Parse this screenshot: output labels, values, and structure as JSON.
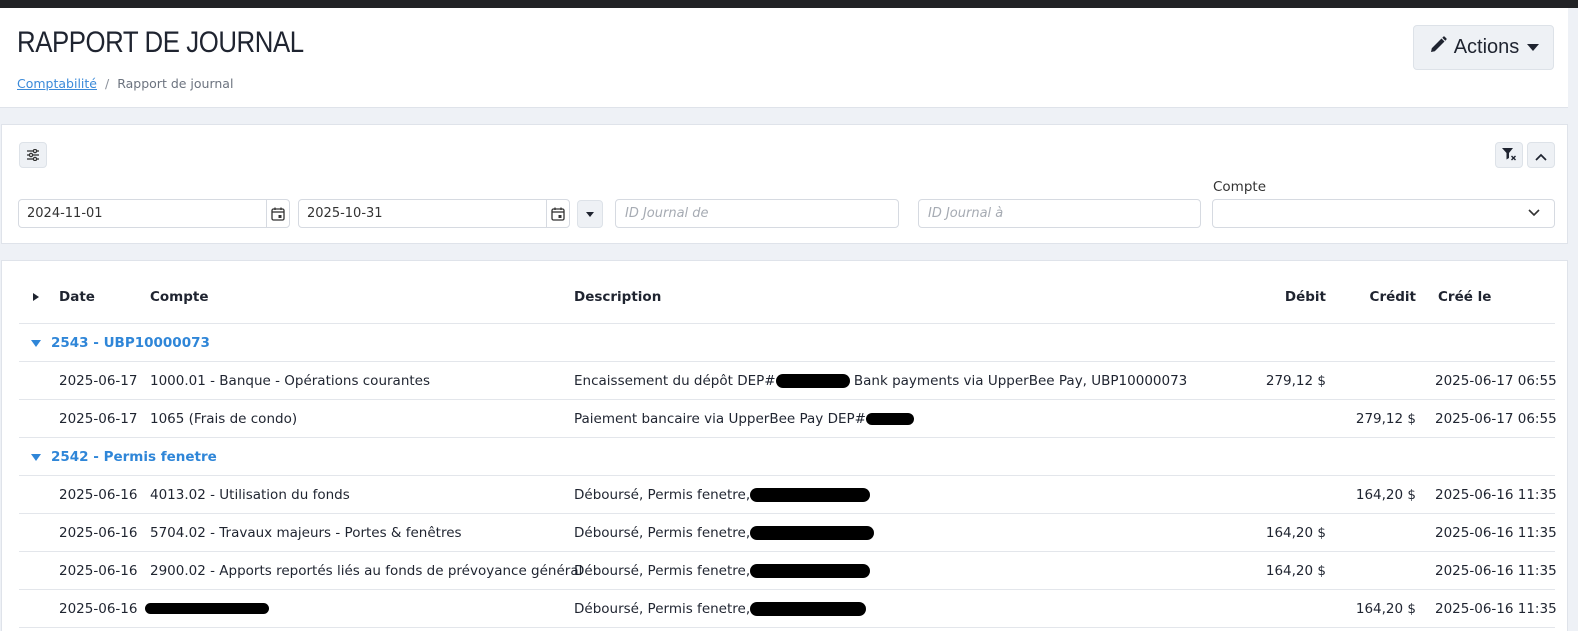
{
  "header": {
    "title": "RAPPORT DE JOURNAL",
    "breadcrumb": {
      "parent": "Comptabilité",
      "separator": "/",
      "current": "Rapport de journal"
    },
    "actions_label": "Actions"
  },
  "filters": {
    "date_from": "2024-11-01",
    "date_to": "2025-10-31",
    "journal_from_placeholder": "ID Journal de",
    "journal_to_placeholder": "ID Journal à",
    "compte_label": "Compte",
    "compte_value": ""
  },
  "table": {
    "columns": {
      "date": "Date",
      "compte": "Compte",
      "description": "Description",
      "debit": "Débit",
      "credit": "Crédit",
      "created": "Créé le"
    },
    "groups": [
      {
        "label": "2543 - UBP10000073",
        "rows": [
          {
            "date": "2025-06-17",
            "compte": "1000.01 - Banque - Opérations courantes",
            "desc_before": "Encaissement du dépôt DEP#",
            "desc_after": "Bank payments via UpperBee Pay, UBP10000073",
            "debit": "279,12 $",
            "credit": "",
            "created": "2025-06-17 06:55"
          },
          {
            "date": "2025-06-17",
            "compte": "1065 (Frais de condo)",
            "desc_before": "Paiement bancaire via UpperBee Pay DEP#",
            "desc_after": "",
            "debit": "",
            "credit": "279,12 $",
            "created": "2025-06-17 06:55"
          }
        ]
      },
      {
        "label": "2542 - Permis fenetre",
        "rows": [
          {
            "date": "2025-06-16",
            "compte": "4013.02 - Utilisation du fonds",
            "desc_before": "Déboursé, Permis fenetre,",
            "desc_after": "",
            "debit": "",
            "credit": "164,20 $",
            "created": "2025-06-16 11:35"
          },
          {
            "date": "2025-06-16",
            "compte": "5704.02 - Travaux majeurs - Portes & fenêtres",
            "desc_before": "Déboursé, Permis fenetre,",
            "desc_after": "",
            "debit": "164,20 $",
            "credit": "",
            "created": "2025-06-16 11:35"
          },
          {
            "date": "2025-06-16",
            "compte": "2900.02 - Apports reportés liés au fonds de prévoyance général",
            "desc_before": "Déboursé, Permis fenetre,",
            "desc_after": "",
            "debit": "164,20 $",
            "credit": "",
            "created": "2025-06-16 11:35"
          },
          {
            "date": "2025-06-16",
            "compte": "",
            "desc_before": "Déboursé, Permis fenetre,",
            "desc_after": "",
            "debit": "",
            "credit": "164,20 $",
            "created": "2025-06-16 11:35"
          }
        ]
      }
    ]
  }
}
